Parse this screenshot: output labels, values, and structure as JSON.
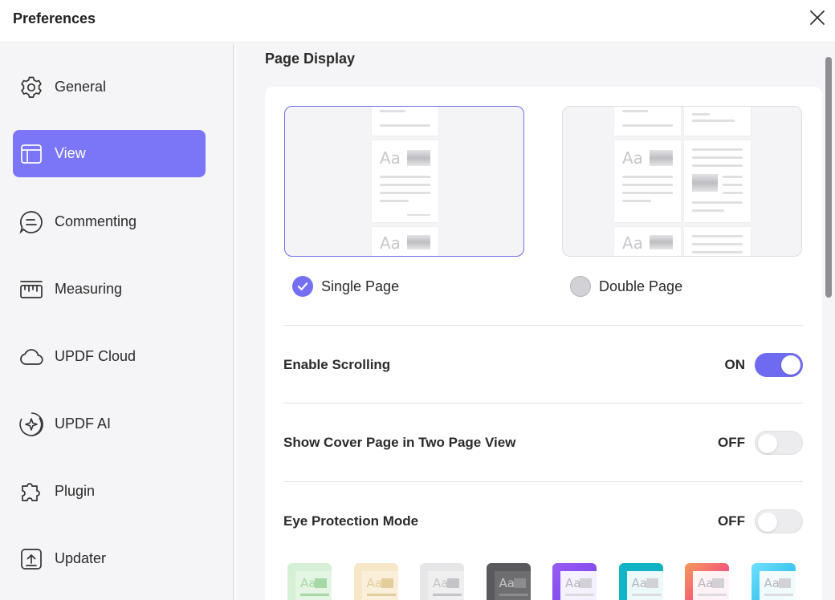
{
  "window": {
    "title": "Preferences"
  },
  "sidebar": {
    "items": [
      {
        "label": "General",
        "icon": "gear-icon"
      },
      {
        "label": "View",
        "icon": "layout-icon",
        "active": true
      },
      {
        "label": "Commenting",
        "icon": "comment-icon"
      },
      {
        "label": "Measuring",
        "icon": "ruler-icon"
      },
      {
        "label": "UPDF Cloud",
        "icon": "cloud-icon"
      },
      {
        "label": "UPDF AI",
        "icon": "ai-sparkle-icon"
      },
      {
        "label": "Plugin",
        "icon": "puzzle-icon"
      },
      {
        "label": "Updater",
        "icon": "update-icon"
      }
    ]
  },
  "main": {
    "section_title": "Page Display",
    "layouts": [
      {
        "label": "Single Page",
        "selected": true
      },
      {
        "label": "Double Page",
        "selected": false
      }
    ],
    "preview_text": "Aa",
    "settings": [
      {
        "label": "Enable Scrolling",
        "state": "ON",
        "on": true
      },
      {
        "label": "Show Cover Page in Two Page View",
        "state": "OFF",
        "on": false
      },
      {
        "label": "Eye Protection Mode",
        "state": "OFF",
        "on": false
      }
    ],
    "eye_protection_swatches": [
      {
        "bg": "#d6f0d6",
        "accent": "#a6d9a6"
      },
      {
        "bg": "#f6e7c8",
        "accent": "#e3cd9d"
      },
      {
        "bg": "#e6e6e8",
        "accent": "#c4c4c8"
      },
      {
        "bg": "#5a5a5e",
        "accent": "#8c8c90"
      },
      {
        "bg": "#8a4cf0",
        "accent": "#ffffff"
      },
      {
        "bg": "#12b3c4",
        "accent": "#ffffff"
      },
      {
        "bg": "#f36b6b",
        "accent": "#ffffff"
      },
      {
        "bg": "#4fd4f0",
        "accent": "#ffffff"
      }
    ],
    "colors": {
      "accent": "#7a76f7",
      "toggle_on": "#6f6bf0"
    }
  }
}
